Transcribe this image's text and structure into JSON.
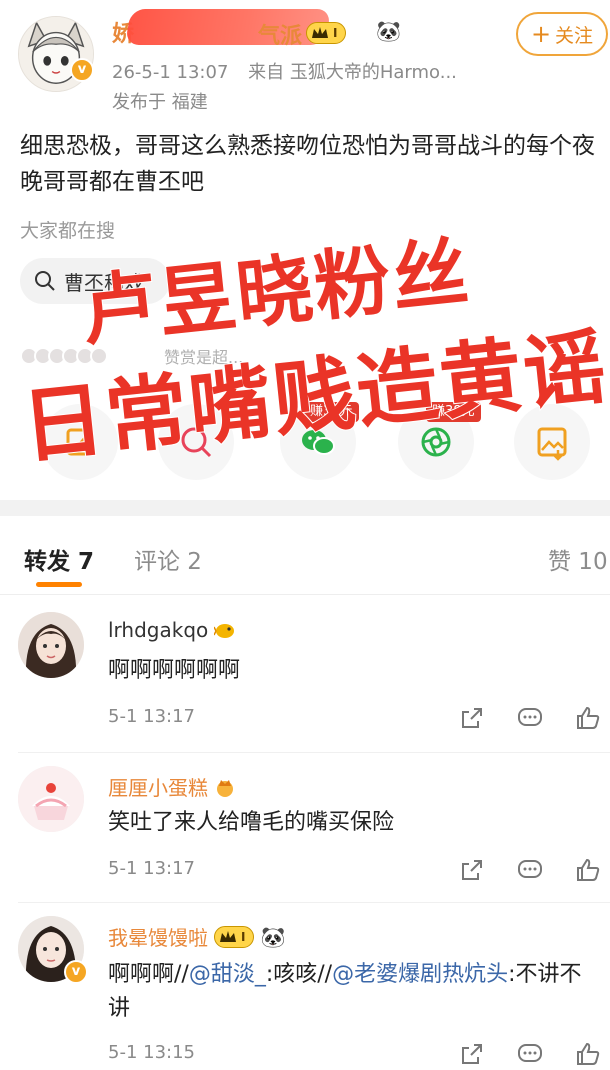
{
  "post": {
    "author_name": "娇",
    "author_name_tail": "气派",
    "level_label": "I",
    "follow_label": "关注",
    "follow_plus": "+",
    "timestamp": "26-5-1 13:07",
    "source": "来自 玉狐大帝的Harmo...",
    "location": "发布于 福建",
    "text": "细思恐极，哥哥这么熟悉接吻位恐怕为哥哥战斗的每个夜晚哥哥都在曹丕吧",
    "search_hint": "大家都在搜",
    "search_chip": "曹丕称戏",
    "likers_text": "赞赏是超..."
  },
  "overlay": {
    "line1": "卢昱晓粉丝",
    "line2": "日常嘴贱造黄谣",
    "color": "#ea3427"
  },
  "share": {
    "items": [
      {
        "icon": "edit-icon",
        "badge": ""
      },
      {
        "icon": "search-share-icon",
        "badge": ""
      },
      {
        "icon": "wechat-icon",
        "badge": "赚38元"
      },
      {
        "icon": "moments-icon",
        "badge": "赚38元"
      },
      {
        "icon": "save-image-icon",
        "badge": ""
      }
    ]
  },
  "tabs": {
    "repost": "转发 7",
    "comments": "评论 2",
    "likes": "赞 10",
    "accent": "#ff8200"
  },
  "comments": [
    {
      "name": "lrhdgakqo",
      "text": "啊啊啊啊啊啊",
      "time": "5-1 13:17"
    },
    {
      "name": "厘厘小蛋糕",
      "text": "笑吐了来人给噜毛的嘴买保险",
      "time": "5-1 13:17"
    },
    {
      "name": "我晕馒馒啦",
      "level_label": "I",
      "text_prefix": "啊啊啊//",
      "mention1": "@甜淡_",
      "text_mid": ":咳咳//",
      "mention2": "@老婆爆剧热炕头",
      "text_suffix": ":不讲不讲",
      "time": "5-1 13:15"
    }
  ]
}
